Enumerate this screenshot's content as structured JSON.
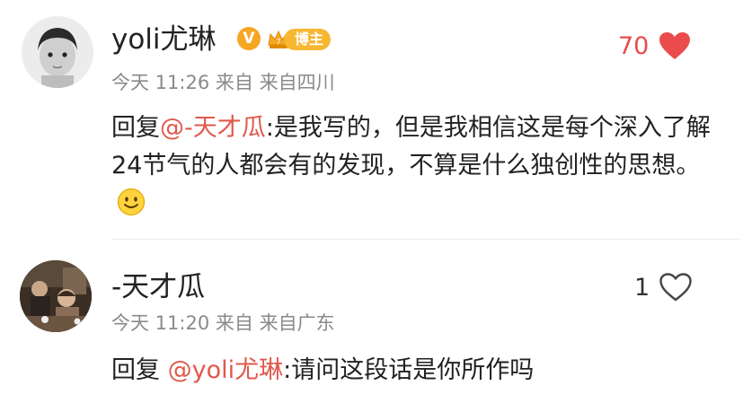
{
  "comments": [
    {
      "username": "yoli尤琳",
      "badge_label": "博主",
      "meta": {
        "time": "今天 11:26",
        "source_prefix": "来自",
        "location": "来自四川"
      },
      "likes": "70",
      "liked": true,
      "body": {
        "reply_prefix": "回复",
        "mention": "@-天才瓜",
        "text": ":是我写的，但是我相信这是每个深入了解24节气的人都会有的发现，不算是什么独创性的思想。"
      }
    },
    {
      "username": "-天才瓜",
      "meta": {
        "time": "今天 11:20",
        "source_prefix": "来自",
        "location": "来自广东"
      },
      "likes": "1",
      "liked": false,
      "body": {
        "reply_prefix": "回复 ",
        "mention": "@yoli尤琳",
        "text": ":请问这段话是你所作吗"
      }
    }
  ],
  "icons": {
    "verified": "verified-v-icon",
    "crown": "crown-icon",
    "heart_filled": "heart-filled-icon",
    "heart_outline": "heart-outline-icon",
    "emoji": "smile-emoji-icon"
  },
  "colors": {
    "mention": "#e0584c",
    "like_active": "#e94b4b",
    "badge": "#f7b733",
    "meta_text": "#8a8a8a"
  }
}
